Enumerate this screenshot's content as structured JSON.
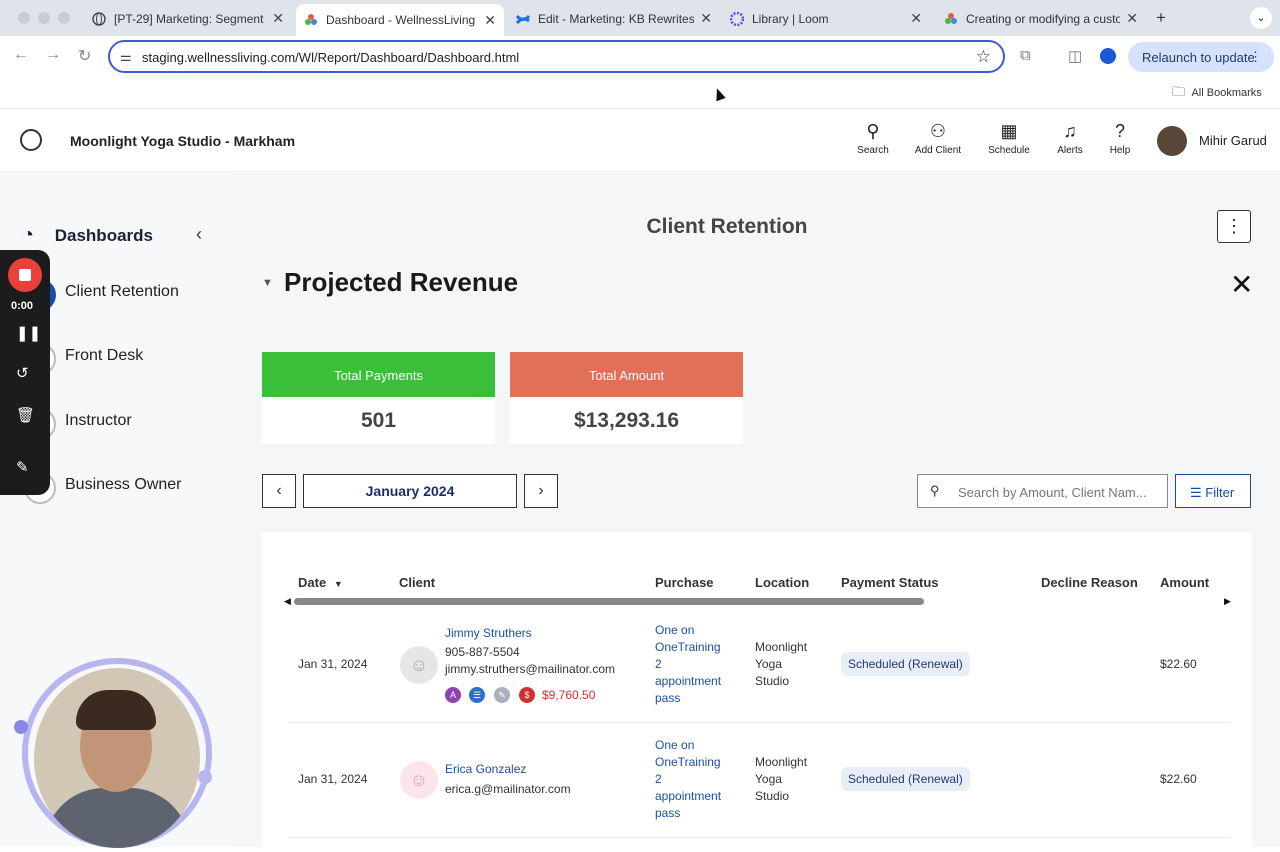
{
  "browser": {
    "tabs": [
      {
        "title": "[PT-29] Marketing: Segment",
        "icon": "globe-icon"
      },
      {
        "title": "Dashboard - WellnessLiving S",
        "icon": "wellnessliving-icon"
      },
      {
        "title": "Edit - Marketing: KB Rewrites",
        "icon": "confluence-icon"
      },
      {
        "title": "Library | Loom",
        "icon": "loom-icon"
      },
      {
        "title": "Creating or modifying a custo",
        "icon": "wellnessliving-icon"
      }
    ],
    "new_tab": "+",
    "url": "staging.wellnessliving.com/Wl/Report/Dashboard/Dashboard.html",
    "relaunch": "Relaunch to update",
    "bookmarks": "All Bookmarks"
  },
  "header": {
    "studio": "Moonlight Yoga Studio - Markham",
    "actions": [
      "Search",
      "Add Client",
      "Schedule",
      "Alerts",
      "Help"
    ],
    "user": "Mihir Garud"
  },
  "sidebar": {
    "title": "Dashboards",
    "items": [
      "Client Retention",
      "Front Desk",
      "Instructor",
      "Business Owner"
    ]
  },
  "recorder": {
    "time": "0:00"
  },
  "main": {
    "page_title": "Client Retention",
    "section_title": "Projected Revenue",
    "cards": [
      {
        "label": "Total Payments",
        "value": "501",
        "color": "#3bbf3b"
      },
      {
        "label": "Total Amount",
        "value": "$13,293.16",
        "color": "#e07058"
      }
    ],
    "month": "January 2024",
    "search_placeholder": "Search by Amount, Client Nam...",
    "filter": "Filter"
  },
  "table": {
    "columns": [
      "Date",
      "Client",
      "Purchase",
      "Location",
      "Payment Status",
      "Decline Reason",
      "Amount"
    ],
    "rows": [
      {
        "date": "Jan 31, 2024",
        "name": "Jimmy Struthers",
        "phone": "905-887-5504",
        "email": "jimmy.struthers@mailinator.com",
        "chips": [
          "A",
          "☰",
          "✎",
          "$"
        ],
        "balance": "$9,760.50",
        "purchase": [
          "One on",
          "OneTraining",
          "2",
          "appointment",
          "pass"
        ],
        "location": [
          "Moonlight",
          "Yoga",
          "Studio"
        ],
        "status": "Scheduled (Renewal)",
        "amount": "$22.60"
      },
      {
        "date": "Jan 31, 2024",
        "name": "Erica Gonzalez",
        "email": "erica.g@mailinator.com",
        "purchase": [
          "One on",
          "OneTraining",
          "2",
          "appointment",
          "pass"
        ],
        "location": [
          "Moonlight",
          "Yoga",
          "Studio"
        ],
        "status": "Scheduled (Renewal)",
        "amount": "$22.60"
      }
    ]
  }
}
